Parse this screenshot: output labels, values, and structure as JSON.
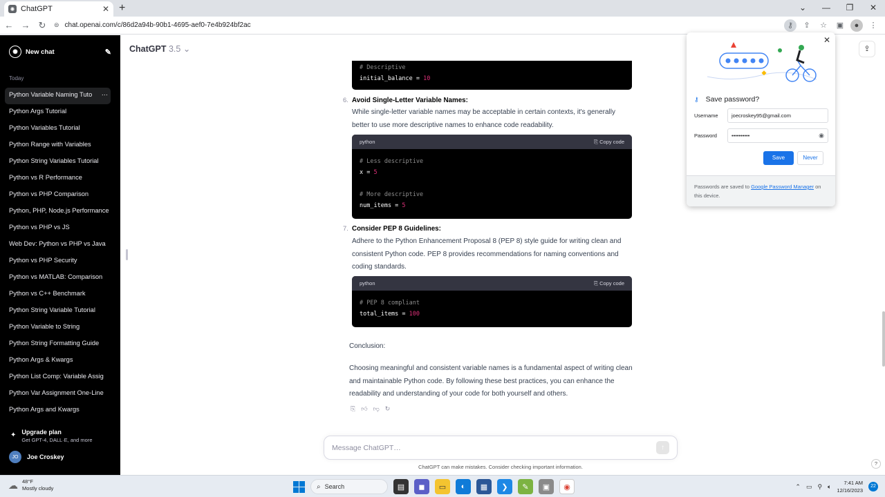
{
  "browser": {
    "tab_title": "ChatGPT",
    "url": "chat.openai.com/c/86d2a94b-90b1-4695-aef0-7e4b924bf2ac"
  },
  "sidebar": {
    "new_chat": "New chat",
    "section_label": "Today",
    "items": [
      "Python Variable Naming Tuto",
      "Python Args Tutorial",
      "Python Variables Tutorial",
      "Python Range with Variables",
      "Python String Variables Tutorial",
      "Python vs R Performance",
      "Python vs PHP Comparison",
      "Python, PHP, Node.js Performance",
      "Python vs PHP vs JS",
      "Web Dev: Python vs PHP vs Java",
      "Python vs PHP Security",
      "Python vs MATLAB: Comparison",
      "Python vs C++ Benchmark",
      "Python String Variable Tutorial",
      "Python Variable to String",
      "Python String Formatting Guide",
      "Python Args & Kwargs",
      "Python List Comp: Variable Assig",
      "Python Var Assignment One-Line",
      "Python Args and Kwargs"
    ],
    "upgrade_title": "Upgrade plan",
    "upgrade_sub": "Get GPT-4, DALL·E, and more",
    "user_initials": "JO",
    "user_name": "Joe Croskey"
  },
  "header": {
    "model": "ChatGPT",
    "version": "3.5"
  },
  "content": {
    "code0": {
      "comment": "# Descriptive",
      "line_var": "initial_balance",
      "line_op": " = ",
      "line_num": "10"
    },
    "item6": {
      "number": "6.",
      "title": "Avoid Single-Letter Variable Names:",
      "text": "While single-letter variable names may be acceptable in certain contexts, it's generally better to use more descriptive names to enhance code readability."
    },
    "code1": {
      "lang": "python",
      "copy": "Copy code",
      "c1": "# Less descriptive",
      "v1": "x",
      "n1": "5",
      "c2": "# More descriptive",
      "v2": "num_items",
      "n2": "5"
    },
    "item7": {
      "number": "7.",
      "title": "Consider PEP 8 Guidelines:",
      "text": "Adhere to the Python Enhancement Proposal 8 (PEP 8) style guide for writing clean and consistent Python code. PEP 8 provides recommendations for naming conventions and coding standards."
    },
    "code2": {
      "lang": "python",
      "copy": "Copy code",
      "c1": "# PEP 8 compliant",
      "v1": "total_items",
      "n1": "100"
    },
    "conclusion_label": "Conclusion:",
    "conclusion_text": "Choosing meaningful and consistent variable names is a fundamental aspect of writing clean and maintainable Python code. By following these best practices, you can enhance the readability and understanding of your code for both yourself and others."
  },
  "composer": {
    "placeholder": "Message ChatGPT…",
    "disclaimer": "ChatGPT can make mistakes. Consider checking important information."
  },
  "password_popup": {
    "title": "Save password?",
    "username_label": "Username",
    "username_value": "joecroskey95@gmail.com",
    "password_label": "Password",
    "password_value": "••••••••••",
    "save": "Save",
    "never": "Never",
    "footer_pre": "Passwords are saved to ",
    "footer_link": "Google Password Manager",
    "footer_post": " on this device."
  },
  "taskbar": {
    "temp": "48°F",
    "weather": "Mostly cloudy",
    "search": "Search",
    "time": "7:41 AM",
    "date": "12/16/2023",
    "notifications": "22"
  }
}
